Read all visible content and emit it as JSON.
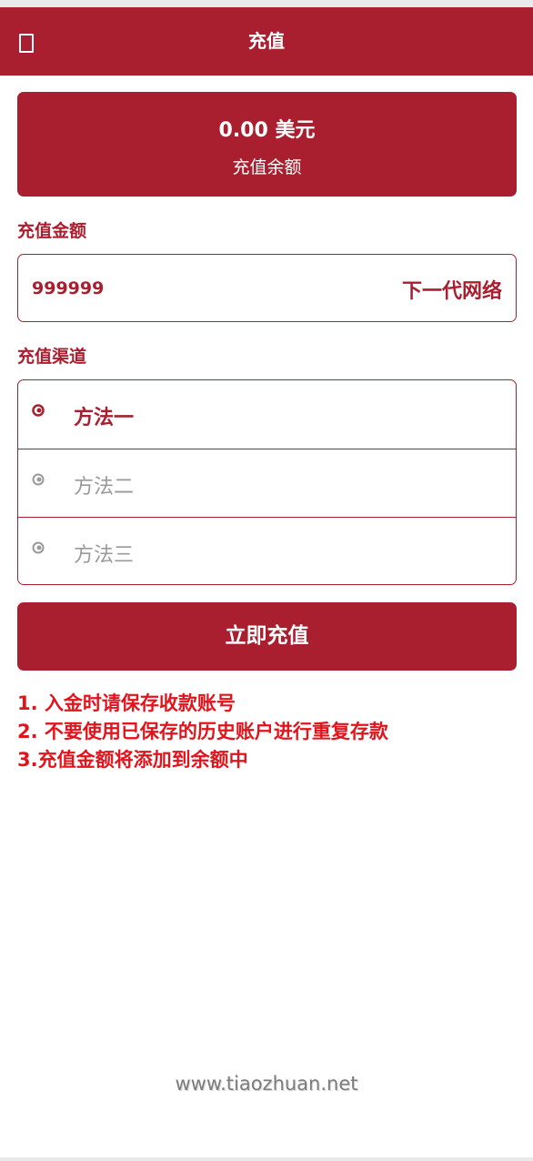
{
  "header": {
    "title": "充值",
    "back_icon": "back-square-icon"
  },
  "balance": {
    "amount": "0.00 美元",
    "caption": "充值余额"
  },
  "amount_section": {
    "label": "充值金额",
    "value": "999999",
    "suffix": "下一代网络"
  },
  "channel_section": {
    "label": "充值渠道",
    "methods": [
      {
        "label": "方法一",
        "selected": true,
        "icon": "radio-selected-icon"
      },
      {
        "label": "方法二",
        "selected": false,
        "icon": "radio-unselected-icon"
      },
      {
        "label": "方法三",
        "selected": false,
        "icon": "radio-unselected-icon"
      }
    ]
  },
  "submit": {
    "label": "立即充值"
  },
  "notes": [
    "1. 入金时请保存收款账号",
    "2. 不要使用已保存的历史账户进行重复存款",
    "3.充值金额将添加到余额中"
  ],
  "watermark": "www.tiaozhuan.net",
  "colors": {
    "brand": "#a91f2f",
    "note_text": "#e3131c",
    "inactive_text": "#9a9a9a"
  }
}
